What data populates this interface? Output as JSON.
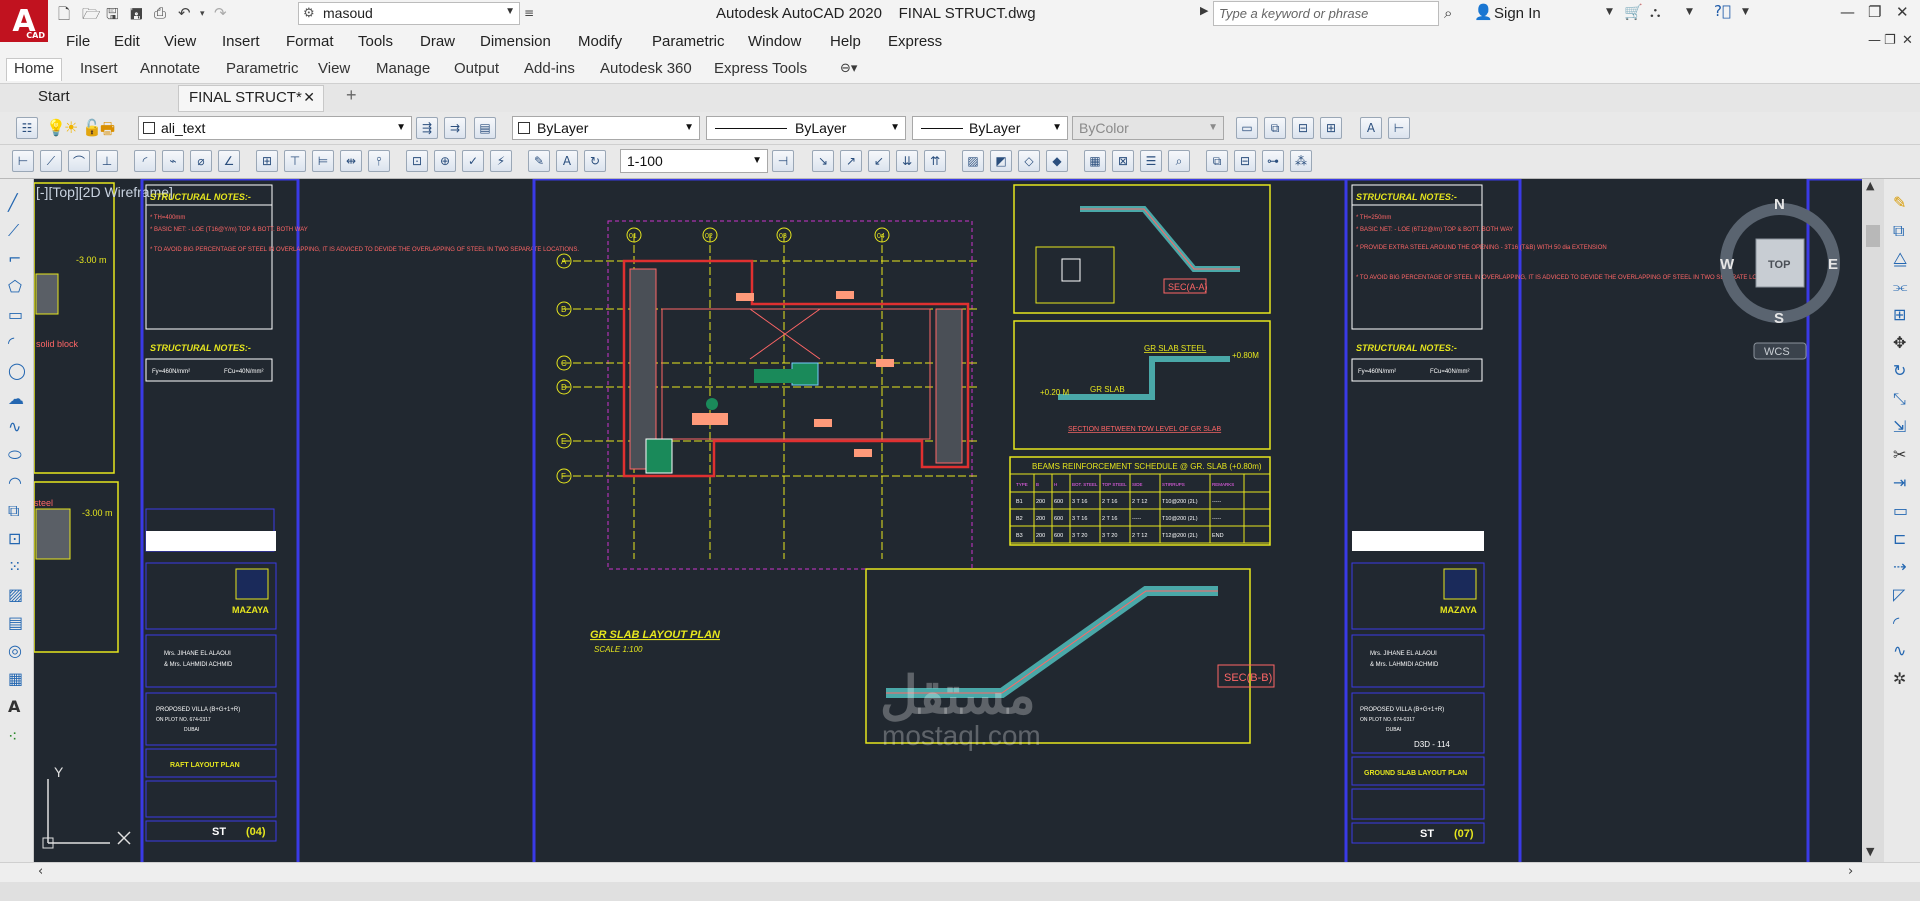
{
  "app": {
    "title": "Autodesk AutoCAD 2020",
    "file": "FINAL STRUCT.dwg",
    "logo": "A",
    "logo_sub": "CAD"
  },
  "workspace": "masoud",
  "search_placeholder": "Type a keyword or phrase",
  "sign_in": "Sign In",
  "menus": [
    "File",
    "Edit",
    "View",
    "Insert",
    "Format",
    "Tools",
    "Draw",
    "Dimension",
    "Modify",
    "Parametric",
    "Window",
    "Help",
    "Express"
  ],
  "ribbon_tabs": [
    "Home",
    "Insert",
    "Annotate",
    "Parametric",
    "View",
    "Manage",
    "Output",
    "Add-ins",
    "Autodesk 360",
    "Express Tools"
  ],
  "doc_tabs": {
    "start": "Start",
    "active": "FINAL STRUCT*"
  },
  "layer": "ali_text",
  "color": "ByLayer",
  "linetype": "ByLayer",
  "lineweight": "ByLayer",
  "plotstyle": "ByColor",
  "scale": "1-100",
  "viewport_label": "[-][Top][2D Wireframe]",
  "viewcube": {
    "top": "TOP",
    "n": "N",
    "s": "S",
    "e": "E",
    "w": "W",
    "wcs": "WCS"
  },
  "ucs": {
    "y": "Y"
  },
  "drawing": {
    "notes_title": "STRUCTURAL NOTES:-",
    "notes_left": [
      "* TH=400mm",
      "* BASIC NET: - LOE (T16@Y/m) TOP & BOTT. BOTH WAY",
      "* TO AVOID BIG PERCENTAGE OF STEEL IN OVERLAPPING, IT IS ADVICED TO DEVIDE THE OVERLAPPING OF STEEL IN TWO SEPARATE LOCATIONS."
    ],
    "notes_right": [
      "* TH=250mm",
      "* BASIC NET: - LOE (6T12@/m) TOP & BOTT. BOTH WAY",
      "* PROVIDE EXTRA STEEL AROUND THE OPENING - 3T16 (T&B) WITH 50 dia EXTENSION",
      "* TO AVOID BIG PERCENTAGE OF STEEL IN OVERLAPPING, IT IS ADVICED TO DEVIDE THE OVERLAPPING OF STEEL IN TWO SEPARATE LOCATIONS."
    ],
    "fy_left": "Fy=460N/mm²",
    "fcu_left": "FCu=40N/mm²",
    "company": "MAZAYA",
    "client_lines": [
      "Mrs. JIHANE EL ALAOUI",
      "& Mrs. LAHMIDI ACHMID"
    ],
    "project_lines": [
      "PROPOSED VILLA (B+G+1+R)",
      "ON PLOT NO. 674-0317",
      "DUBAI"
    ],
    "title_left": "RAFT LAYOUT PLAN",
    "title_right": "GROUND SLAB LAYOUT PLAN",
    "sheet_left": "(04)",
    "sheet_right": "(07)",
    "sheet_prefix": "ST",
    "dwg_no": "D3D - 114",
    "plan_title": "GR SLAB LAYOUT PLAN",
    "plan_scale": "SCALE 1:100",
    "grid_cols": [
      "01",
      "02",
      "03",
      "04"
    ],
    "grid_rows": [
      "A",
      "B",
      "C",
      "D",
      "E",
      "F"
    ],
    "sec_aa": "SEC(A-A)",
    "sec_bb": "SEC(B-B)",
    "sec_between": "SECTION BETWEEN TOW LEVEL OF GR SLAB",
    "gr_slab_steel": "GR SLAB STEEL",
    "gr_slab": "GR SLAB",
    "level_high": "+0.80M",
    "level_low": "+0.20 M",
    "level_left_a": "-3.00 m",
    "level_left_b": "-3.00 m",
    "solid_block": "solid block",
    "steel_label": "steel",
    "schedule_title": "BEAMS REINFORCEMENT SCHEDULE @ GR. SLAB (+0.80m)",
    "schedule_headers": [
      "TYPE",
      "B",
      "H",
      "BOT. STEEL",
      "TOP STEEL",
      "SIDE",
      "STIRRUPS",
      "REMARKS"
    ],
    "schedule_rows": [
      [
        "B1",
        "200",
        "600",
        "3 T 16",
        "2 T 16",
        "2 T 12",
        "T10@200 (2L)",
        "-----"
      ],
      [
        "B2",
        "200",
        "600",
        "3 T 16",
        "2 T 16",
        "-----",
        "T10@200 (2L)",
        "-----"
      ],
      [
        "B3",
        "200",
        "600",
        "3 T 20",
        "3 T 20",
        "2 T 12",
        "T12@200 (2L)",
        "END"
      ]
    ],
    "watermark_ar": "مستقل",
    "watermark_en": "mostaql.com"
  }
}
